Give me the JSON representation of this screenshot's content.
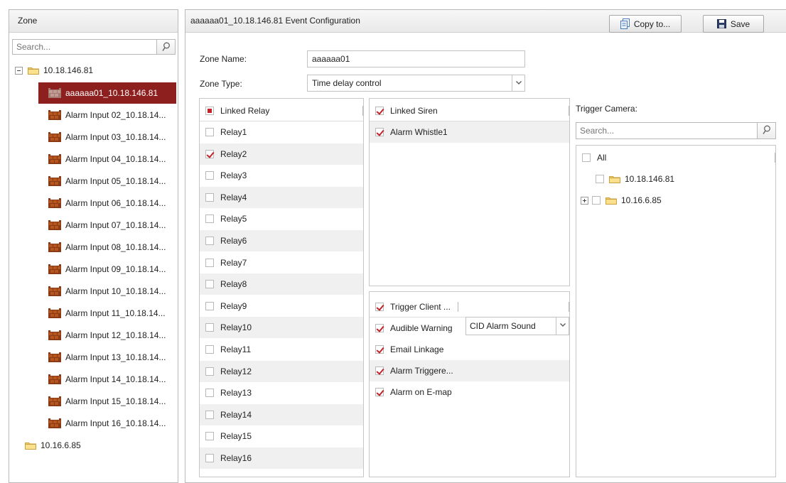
{
  "left": {
    "title": "Zone",
    "search_placeholder": "Search...",
    "root_device": "10.18.146.81",
    "zones": [
      "aaaaaa01_10.18.146.81",
      "Alarm Input 02_10.18.14...",
      "Alarm Input 03_10.18.14...",
      "Alarm Input 04_10.18.14...",
      "Alarm Input 05_10.18.14...",
      "Alarm Input 06_10.18.14...",
      "Alarm Input 07_10.18.14...",
      "Alarm Input 08_10.18.14...",
      "Alarm Input 09_10.18.14...",
      "Alarm Input 10_10.18.14...",
      "Alarm Input 11_10.18.14...",
      "Alarm Input 12_10.18.14...",
      "Alarm Input 13_10.18.14...",
      "Alarm Input 14_10.18.14...",
      "Alarm Input 15_10.18.14...",
      "Alarm Input 16_10.18.14..."
    ],
    "second_device": "10.16.6.85"
  },
  "header": {
    "title": "aaaaaa01_10.18.146.81 Event Configuration",
    "copy_label": "Copy to...",
    "save_label": "Save"
  },
  "form": {
    "zone_name_label": "Zone Name:",
    "zone_name_value": "aaaaaa01",
    "zone_type_label": "Zone Type:",
    "zone_type_value": "Time delay control"
  },
  "relay": {
    "header": "Linked Relay",
    "items": [
      {
        "label": "Relay1",
        "checked": false
      },
      {
        "label": "Relay2",
        "checked": true
      },
      {
        "label": "Relay3",
        "checked": false
      },
      {
        "label": "Relay4",
        "checked": false
      },
      {
        "label": "Relay5",
        "checked": false
      },
      {
        "label": "Relay6",
        "checked": false
      },
      {
        "label": "Relay7",
        "checked": false
      },
      {
        "label": "Relay8",
        "checked": false
      },
      {
        "label": "Relay9",
        "checked": false
      },
      {
        "label": "Relay10",
        "checked": false
      },
      {
        "label": "Relay11",
        "checked": false
      },
      {
        "label": "Relay12",
        "checked": false
      },
      {
        "label": "Relay13",
        "checked": false
      },
      {
        "label": "Relay14",
        "checked": false
      },
      {
        "label": "Relay15",
        "checked": false
      },
      {
        "label": "Relay16",
        "checked": false
      }
    ]
  },
  "siren": {
    "header": "Linked Siren",
    "items": [
      {
        "label": "Alarm Whistle1",
        "checked": true
      }
    ]
  },
  "client": {
    "header": "Trigger Client ...",
    "audible_label": "Audible Warning",
    "audible_value": "CID Alarm Sound",
    "email_label": "Email Linkage",
    "alarm_triggered_label": "Alarm Triggere...",
    "emap_label": "Alarm on E-map"
  },
  "camera": {
    "title": "Trigger Camera:",
    "search_placeholder": "Search...",
    "all_label": "All",
    "devices": [
      "10.18.146.81",
      "10.16.6.85"
    ]
  },
  "colors": {
    "selection": "#8e1f1f",
    "check": "#c0232a"
  }
}
